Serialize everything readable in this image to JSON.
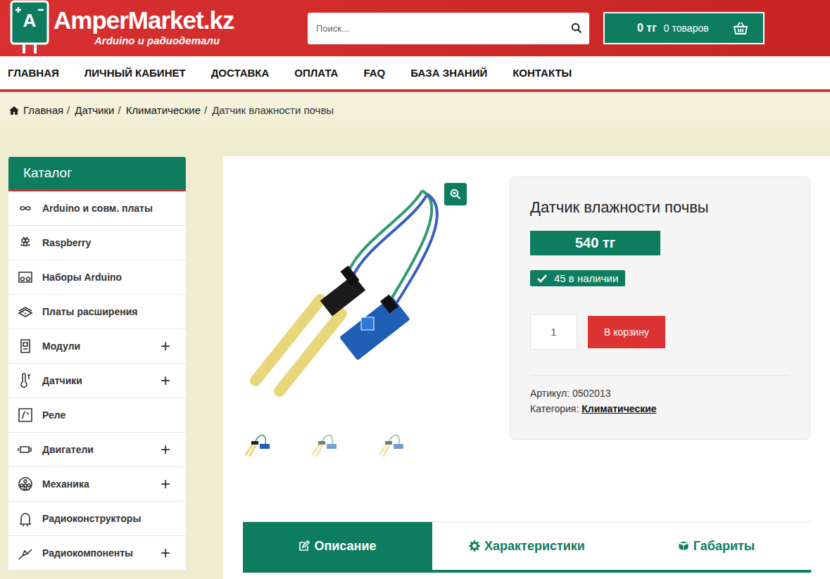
{
  "header": {
    "logo_badge": "A",
    "logo_title": "AmperMarket.kz",
    "logo_subtitle": "Arduino и радиодетали",
    "search": {
      "placeholder": "Поиск..."
    },
    "cart": {
      "total": "0 тг",
      "count": "0 товаров"
    }
  },
  "nav": [
    "ГЛАВНАЯ",
    "ЛИЧНЫЙ КАБИНЕТ",
    "ДОСТАВКА",
    "ОПЛАТА",
    "FAQ",
    "БАЗА ЗНАНИЙ",
    "КОНТАКТЫ"
  ],
  "breadcrumb_separator": "/",
  "breadcrumbs": [
    {
      "label": "Главная",
      "link": true
    },
    {
      "label": "Датчики",
      "link": true
    },
    {
      "label": "Климатические",
      "link": true
    },
    {
      "label": "Датчик влажности почвы",
      "link": false
    }
  ],
  "sidebar": {
    "title": "Каталог",
    "expand_mark": "+",
    "items": [
      {
        "label": "Arduino и совм. платы",
        "expandable": false
      },
      {
        "label": "Raspberry",
        "expandable": false
      },
      {
        "label": "Наборы Arduino",
        "expandable": false
      },
      {
        "label": "Платы расширения",
        "expandable": false
      },
      {
        "label": "Модули",
        "expandable": true
      },
      {
        "label": "Датчики",
        "expandable": true
      },
      {
        "label": "Реле",
        "expandable": false
      },
      {
        "label": "Двигатели",
        "expandable": true
      },
      {
        "label": "Механика",
        "expandable": true
      },
      {
        "label": "Радиоконструкторы",
        "expandable": false
      },
      {
        "label": "Радиокомпоненты",
        "expandable": true
      }
    ]
  },
  "gallery": {
    "thumbs": [
      {
        "selected": true
      },
      {
        "selected": false
      },
      {
        "selected": false
      }
    ]
  },
  "product": {
    "title": "Датчик влажности почвы",
    "price": "540 тг",
    "in_stock": true,
    "stock": "45 в наличии",
    "quantity": "1",
    "add_button": "В корзину",
    "sku_label": "Артикул:",
    "sku": "0502013",
    "category_label": "Категория:",
    "category": "Климатические"
  },
  "tabs": [
    {
      "label": "Описание",
      "selected": true
    },
    {
      "label": "Характеристики",
      "selected": false
    },
    {
      "label": "Габариты",
      "selected": false
    }
  ]
}
